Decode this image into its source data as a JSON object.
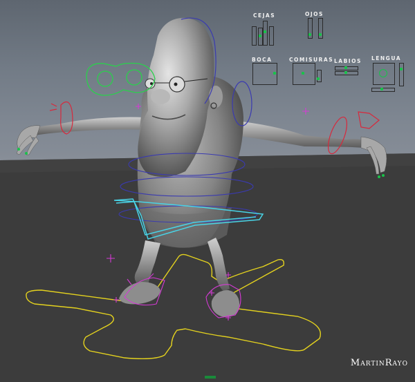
{
  "viewport": {
    "title": "Maya character rig viewport"
  },
  "control_panel": {
    "cejas": "CEJAS",
    "ojos": "OJOS",
    "boca": "BOCA",
    "comisuras": "COMISURAS",
    "labios": "LABIOS",
    "lengua": "LENGUA"
  },
  "watermark": "MartinRayo",
  "colors": {
    "background_top": "#5e6670",
    "background_bottom": "#8a9099",
    "floor": "#3b3b3b",
    "control_red": "#d8283c",
    "control_blue": "#3a3ab0",
    "control_cyan": "#49d3e6",
    "control_green": "#2ad14c",
    "control_yellow": "#e4d21e",
    "control_magenta": "#d63ad6"
  }
}
